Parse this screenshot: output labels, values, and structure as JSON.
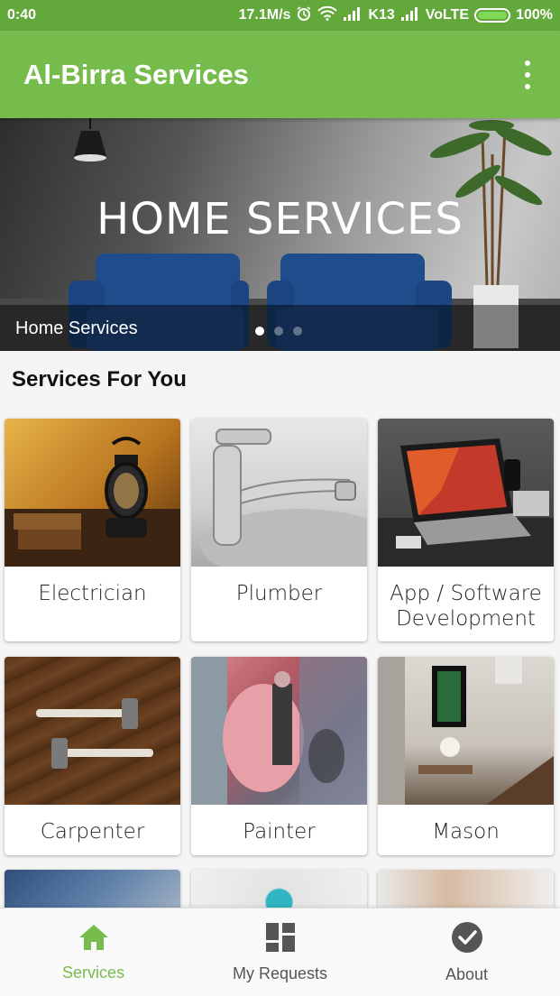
{
  "status_bar": {
    "time": "0:40",
    "speed": "17.1M/s",
    "carrier": "K13",
    "network": "VoLTE",
    "battery": "100%"
  },
  "app_bar": {
    "title": "Al-Birra Services",
    "overflow_icon": "more-vert-icon"
  },
  "banner": {
    "heading": "HOME SERVICES",
    "caption": "Home Services",
    "slide_count": 3,
    "active_slide": 1
  },
  "section": {
    "title": "Services For You"
  },
  "services": [
    {
      "label": "Electrician",
      "image": "lantern-image"
    },
    {
      "label": "Plumber",
      "image": "faucet-image"
    },
    {
      "label": "App / Software Development",
      "image": "laptop-image"
    },
    {
      "label": "Carpenter",
      "image": "axes-image"
    },
    {
      "label": "Painter",
      "image": "mural-painter-image"
    },
    {
      "label": "Mason",
      "image": "interior-room-image"
    }
  ],
  "bottom_nav": {
    "items": [
      {
        "label": "Services",
        "icon": "home-icon",
        "active": true
      },
      {
        "label": "My Requests",
        "icon": "dashboard-icon",
        "active": false
      },
      {
        "label": "About",
        "icon": "check-circle-icon",
        "active": false
      }
    ]
  },
  "colors": {
    "status_bar": "#62a83a",
    "app_bar": "#76bc4c",
    "accent": "#76bc4c",
    "nav_inactive": "#555555"
  }
}
